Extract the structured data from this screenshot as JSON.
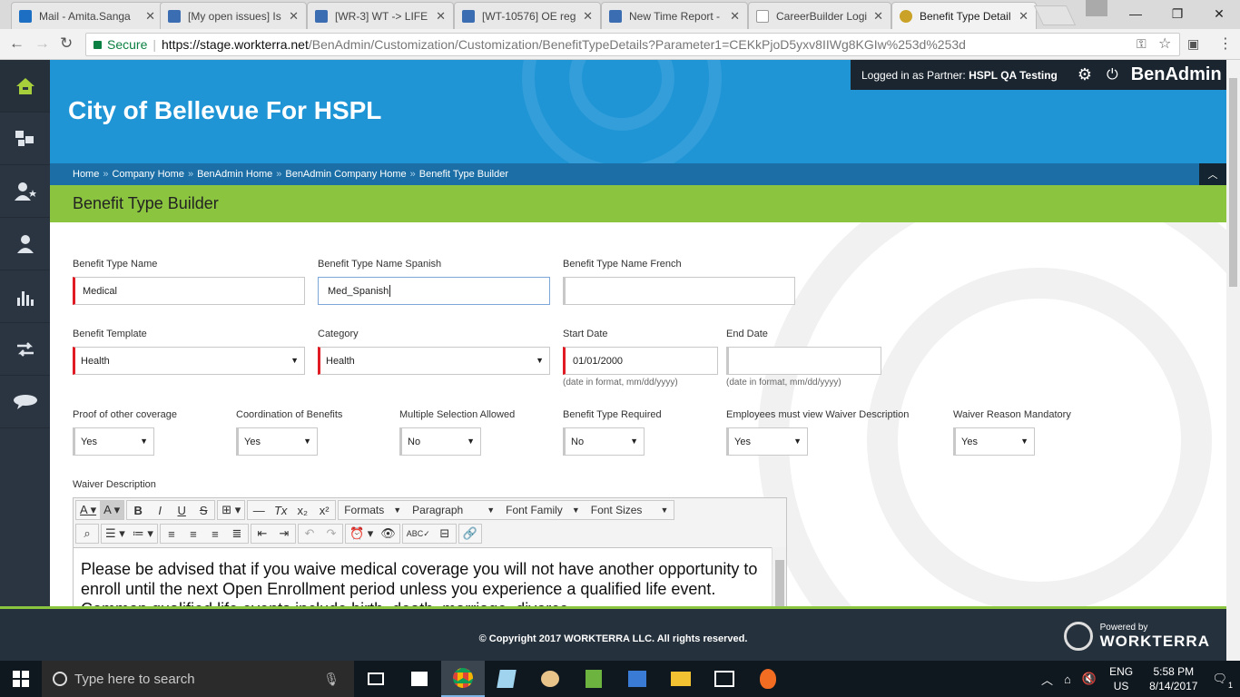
{
  "browser": {
    "tabs": [
      {
        "label": "Mail - Amita.Sanga",
        "icon_color": "#1d6fc4"
      },
      {
        "label": "[My open issues] Is",
        "icon_color": "#3b6db3"
      },
      {
        "label": "[WR-3] WT -> LIFE",
        "icon_color": "#3b6db3"
      },
      {
        "label": "[WT-10576] OE reg",
        "icon_color": "#3b6db3"
      },
      {
        "label": "New Time Report -",
        "icon_color": "#3b6db3"
      },
      {
        "label": "CareerBuilder Logi",
        "icon_color": "#999999"
      },
      {
        "label": "Benefit Type Detail",
        "icon_color": "#c9a227"
      }
    ],
    "secure_label": "Secure",
    "url_host": "https://stage.workterra.net",
    "url_path": "/BenAdmin/Customization/Customization/BenefitTypeDetails?Parameter1=CEKkPjoD5yxv8IIWg8KGIw%253d%253d"
  },
  "header": {
    "company": "City of Bellevue For HSPL",
    "logged_in_prefix": "Logged in as Partner:",
    "logged_in_user": "HSPL QA Testing",
    "brand": "BenAdmin"
  },
  "breadcrumb": [
    "Home",
    "Company Home",
    "BenAdmin Home",
    "BenAdmin Company Home",
    "Benefit Type Builder"
  ],
  "page_title": "Benefit Type Builder",
  "form": {
    "name_label": "Benefit Type Name",
    "name_value": "Medical",
    "spanish_label": "Benefit Type Name Spanish",
    "spanish_value": "Med_Spanish",
    "french_label": "Benefit Type Name French",
    "french_value": "",
    "template_label": "Benefit Template",
    "template_value": "Health",
    "category_label": "Category",
    "category_value": "Health",
    "start_label": "Start Date",
    "start_value": "01/01/2000",
    "end_label": "End Date",
    "end_value": "",
    "date_hint": "(date in format, mm/dd/yyyy)",
    "proof_label": "Proof of other coverage",
    "proof_value": "Yes",
    "coord_label": "Coordination of Benefits",
    "coord_value": "Yes",
    "multi_label": "Multiple Selection Allowed",
    "multi_value": "No",
    "required_label": "Benefit Type Required",
    "required_value": "No",
    "waiver_view_label": "Employees must view Waiver Description",
    "waiver_view_value": "Yes",
    "waiver_reason_label": "Waiver Reason Mandatory",
    "waiver_reason_value": "Yes",
    "waiver_desc_label": "Waiver Description"
  },
  "editor": {
    "formats": "Formats",
    "paragraph": "Paragraph",
    "font_family": "Font Family",
    "font_sizes": "Font Sizes",
    "content": "Please be advised that if you waive medical coverage you will not have another opportunity to enroll until the next Open Enrollment period unless you experience a qualified life event. Common qualified life events include birth, death, marriage, divorce"
  },
  "footer": {
    "copyright": "© Copyright 2017 WORKTERRA LLC. All rights reserved.",
    "powered_by": "Powered by",
    "powered_brand": "WORKTERRA"
  },
  "taskbar": {
    "search_placeholder": "Type here to search",
    "lang_top": "ENG",
    "lang_bottom": "US",
    "time": "5:58 PM",
    "date": "8/14/2017",
    "notifications": "1"
  },
  "colors": {
    "banner": "#1f95d6",
    "page_title_bar": "#8bc53f",
    "sidebar": "#2b3542",
    "required_marker": "#e01b24"
  }
}
